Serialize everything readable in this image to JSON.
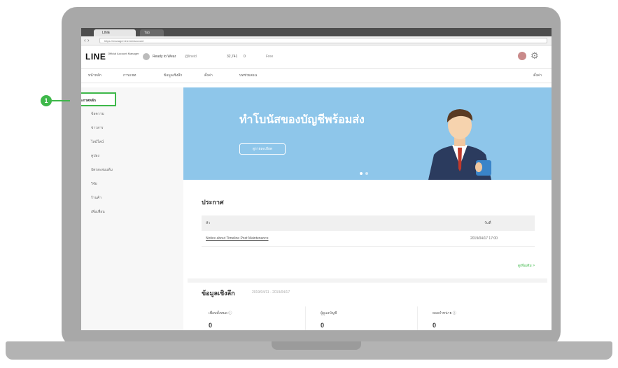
{
  "browser": {
    "tab_label": "LINE",
    "tab2_label": "Tab",
    "url": "https://manager.line.biz/account"
  },
  "app": {
    "logo": "LINE",
    "logo_sub": "Official Account Manager",
    "account_name": "Ready to Wear",
    "account_id": "@lineid",
    "friends": "32,741",
    "msg_count": "0",
    "plan": "Free"
  },
  "menu": {
    "items": [
      "หน้าหลัก",
      "การแชท",
      "ข้อมูลเชิงลึก",
      "ตั้งค่า",
      "บทช่วยสอน"
    ],
    "right": "ตั้งค่า"
  },
  "sidebar": {
    "active": "ประกาศหลัก",
    "items": [
      "ข้อความ",
      "ข่าวสาร",
      "ไทม์ไลน์",
      "คูปอง",
      "บัตรสะสมแต้ม",
      "วิจัย",
      "ร้านค้า",
      "เพิ่มเพื่อน"
    ]
  },
  "callout": {
    "number": "1"
  },
  "banner": {
    "title": "ทำโบนัสของบัญชีพร้อมส่ง",
    "button": "ดูรายละเอียด"
  },
  "announce": {
    "title": "ประกาศ",
    "col_title": "หัว",
    "col_date": "วันที่",
    "row_link": "Notice about Timeline Post Maintenance",
    "row_date": "2019/04/17 17:00",
    "more": "ดูเพิ่มเติม >"
  },
  "info": {
    "title": "ข้อมูลเชิงลึก",
    "range": "2019/04/11 - 2019/04/17",
    "stats": [
      {
        "label": "เพื่อนทั้งหมด ⓘ",
        "value": "0"
      },
      {
        "label": "ผู้ดูแลบัญชี",
        "value": "0"
      },
      {
        "label": "ยอดจำหน่าย ⓘ",
        "value": "0"
      }
    ]
  },
  "colors": {
    "accent": "#3eb84a",
    "banner": "#8ec6ea",
    "laptop": "#a8a8a8"
  }
}
